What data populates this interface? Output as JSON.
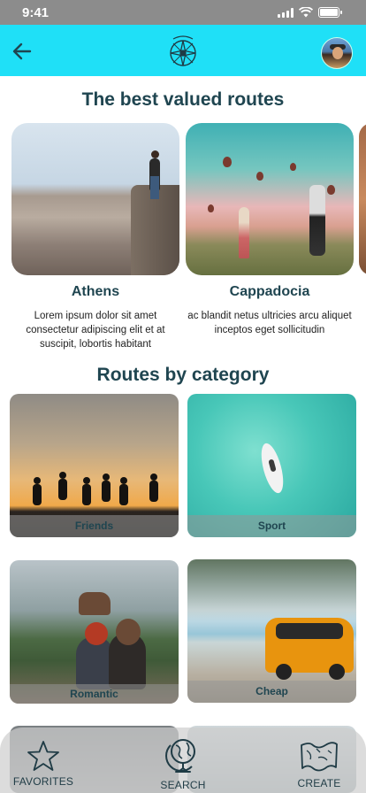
{
  "status_bar": {
    "time": "9:41"
  },
  "header": {
    "back_icon": "arrow-left-icon",
    "logo_icon": "compass-logo-icon",
    "avatar": "user-avatar"
  },
  "sections": {
    "best_routes_title": "The best valued routes",
    "categories_title": "Routes by category"
  },
  "routes": [
    {
      "name": "Athens",
      "description": "Lorem ipsum dolor sit amet consectetur adipiscing elit et at suscipit, lobortis habitant"
    },
    {
      "name": "Cappadocia",
      "description": "ac blandit netus ultricies arcu aliquet inceptos eget sollicitudin"
    }
  ],
  "categories": [
    {
      "label": "Friends"
    },
    {
      "label": "Sport"
    },
    {
      "label": "Romantic"
    },
    {
      "label": "Cheap"
    }
  ],
  "bottom_nav": [
    {
      "label": "FAVORITES",
      "icon": "star-icon"
    },
    {
      "label": "SEARCH",
      "icon": "globe-icon"
    },
    {
      "label": "CREATE",
      "icon": "map-icon"
    }
  ],
  "colors": {
    "header_bg": "#1fe0f7",
    "title": "#1f4550",
    "status_bar": "#8c8c8c"
  }
}
